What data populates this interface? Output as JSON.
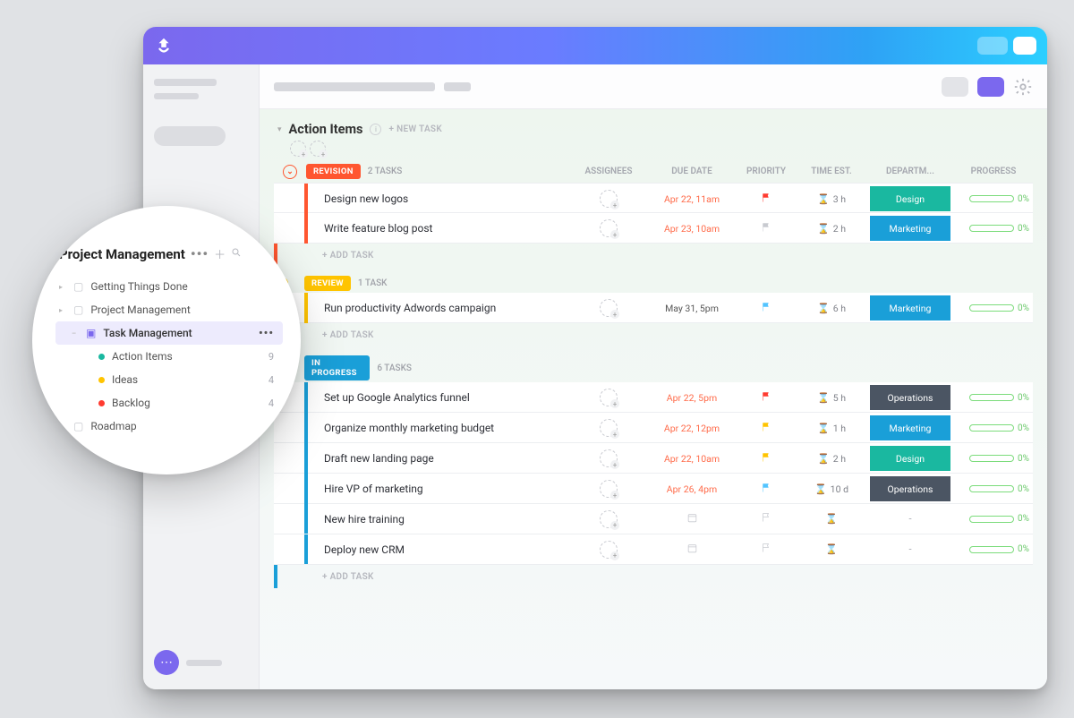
{
  "header": {
    "list_title": "Action Items",
    "new_task_label": "+ NEW TASK",
    "columns": {
      "assignees": "ASSIGNEES",
      "due": "DUE DATE",
      "priority": "PRIORITY",
      "time_est": "TIME EST.",
      "department": "DEPARTM...",
      "progress": "PROGRESS"
    },
    "add_task_label": "+ ADD TASK"
  },
  "groups": [
    {
      "status_label": "REVISION",
      "status_color": "#ff5630",
      "count_label": "2 TASKS",
      "collapse_color": "#ff5630",
      "tasks": [
        {
          "name": "Design new logos",
          "due": "Apr 22, 11am",
          "due_color": "#ff6b4a",
          "flag_color": "#ff3b30",
          "time": "3 h",
          "dept": "Design",
          "dept_color": "#1ab8a0",
          "progress": "0%"
        },
        {
          "name": "Write feature blog post",
          "due": "Apr 23, 10am",
          "due_color": "#ff6b4a",
          "flag_color": "#c8cad0",
          "time": "2 h",
          "dept": "Marketing",
          "dept_color": "#1a9fd8",
          "progress": "0%"
        }
      ]
    },
    {
      "status_label": "REVIEW",
      "status_color": "#ffc400",
      "count_label": "1 TASK",
      "collapse_color": "#ffc400",
      "tasks": [
        {
          "name": "Run productivity Adwords campaign",
          "due": "May 31, 5pm",
          "due_color": "#555",
          "flag_color": "#52c4ff",
          "time": "6 h",
          "dept": "Marketing",
          "dept_color": "#1a9fd8",
          "progress": "0%"
        }
      ]
    },
    {
      "status_label": "IN PROGRESS",
      "status_color": "#1a9fd8",
      "count_label": "6 TASKS",
      "collapse_color": "#1a9fd8",
      "tasks": [
        {
          "name": "Set up Google Analytics funnel",
          "due": "Apr 22, 5pm",
          "due_color": "#ff6b4a",
          "flag_color": "#ff3b30",
          "time": "5 h",
          "dept": "Operations",
          "dept_color": "#4b5563",
          "progress": "0%"
        },
        {
          "name": "Organize monthly marketing budget",
          "due": "Apr 22, 12pm",
          "due_color": "#ff6b4a",
          "flag_color": "#ffc400",
          "time": "1 h",
          "dept": "Marketing",
          "dept_color": "#1a9fd8",
          "progress": "0%"
        },
        {
          "name": "Draft new landing page",
          "due": "Apr 22, 10am",
          "due_color": "#ff6b4a",
          "flag_color": "#ffc400",
          "time": "2 h",
          "dept": "Design",
          "dept_color": "#1ab8a0",
          "progress": "0%"
        },
        {
          "name": "Hire VP of marketing",
          "due": "Apr 26, 4pm",
          "due_color": "#ff6b4a",
          "flag_color": "#52c4ff",
          "time": "10 d",
          "dept": "Operations",
          "dept_color": "#4b5563",
          "progress": "0%"
        },
        {
          "name": "New hire training",
          "due": "",
          "due_color": "",
          "flag_color": "",
          "time": "",
          "dept": "-",
          "dept_color": "",
          "progress": "0%"
        },
        {
          "name": "Deploy new CRM",
          "due": "",
          "due_color": "",
          "flag_color": "",
          "time": "",
          "dept": "-",
          "dept_color": "",
          "progress": "0%"
        }
      ]
    }
  ],
  "bubble": {
    "title": "Project Management",
    "items": [
      {
        "type": "folder",
        "label": "Getting Things Done"
      },
      {
        "type": "folder",
        "label": "Project Management"
      },
      {
        "type": "open-folder",
        "label": "Task Management",
        "active": true,
        "indent": "lev2"
      },
      {
        "type": "list",
        "label": "Action Items",
        "dot": "#1ab8a0",
        "count": "9",
        "indent": "sub-item"
      },
      {
        "type": "list",
        "label": "Ideas",
        "dot": "#ffc400",
        "count": "4",
        "indent": "sub-item"
      },
      {
        "type": "list",
        "label": "Backlog",
        "dot": "#ff3b30",
        "count": "4",
        "indent": "sub-item"
      },
      {
        "type": "folder",
        "label": "Roadmap"
      }
    ]
  },
  "colors": {
    "design": "#1ab8a0",
    "marketing": "#1a9fd8",
    "operations": "#4b5563"
  }
}
